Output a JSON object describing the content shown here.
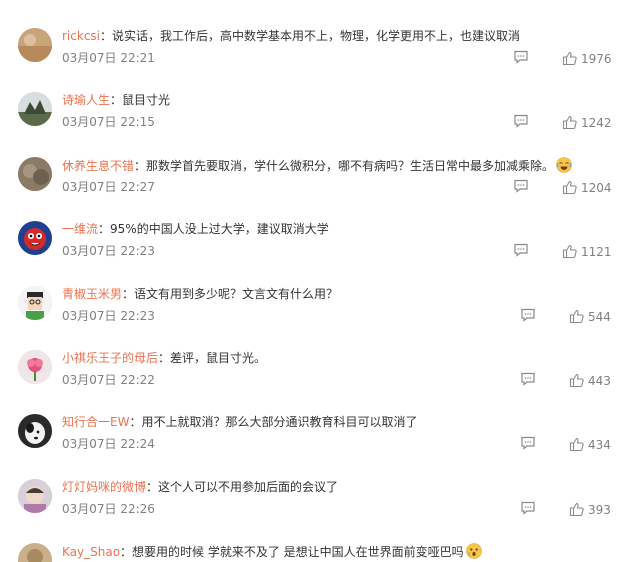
{
  "comments": [
    {
      "username": "rickcsi",
      "text": "说实话，我工作后，高中数学基本用不上，物理，化学更用不上，也建议取消",
      "time": "03月07日 22:21",
      "likes": "1976"
    },
    {
      "username": "诗瑜人生",
      "text": "鼠目寸光",
      "time": "03月07日 22:15",
      "likes": "1242"
    },
    {
      "username": "休养生息不错",
      "text": "那数学首先要取消，学什么微积分，哪不有病吗？生活日常中最多加减乘除。",
      "time": "03月07日 22:27",
      "likes": "1204",
      "emoji": "crying-laughing-emoji"
    },
    {
      "username": "一维流",
      "text": "95%的中国人没上过大学，建议取消大学",
      "time": "03月07日 22:23",
      "likes": "1121"
    },
    {
      "username": "青椒玉米男",
      "text": "语文有用到多少呢？文言文有什么用？",
      "time": "03月07日 22:23",
      "likes": "544"
    },
    {
      "username": "小祺乐王子的母后",
      "text": "差评，鼠目寸光。",
      "time": "03月07日 22:22",
      "likes": "443"
    },
    {
      "username": "知行合一EW",
      "text": "用不上就取消？那么大部分通识教育科目可以取消了",
      "time": "03月07日 22:24",
      "likes": "434"
    },
    {
      "username": "灯灯妈咪的微博",
      "text": "这个人可以不用参加后面的会议了",
      "time": "03月07日 22:26",
      "likes": "393"
    },
    {
      "username": "Kay_Shao",
      "text": "想要用的时候 学就来不及了 是想让中国人在世界面前变哑巴吗",
      "time": "",
      "likes": "",
      "emoji": "shocked-emoji"
    }
  ],
  "separator": "：",
  "colors": {
    "username": "#eb7350",
    "text": "#333333",
    "meta": "#808080"
  }
}
